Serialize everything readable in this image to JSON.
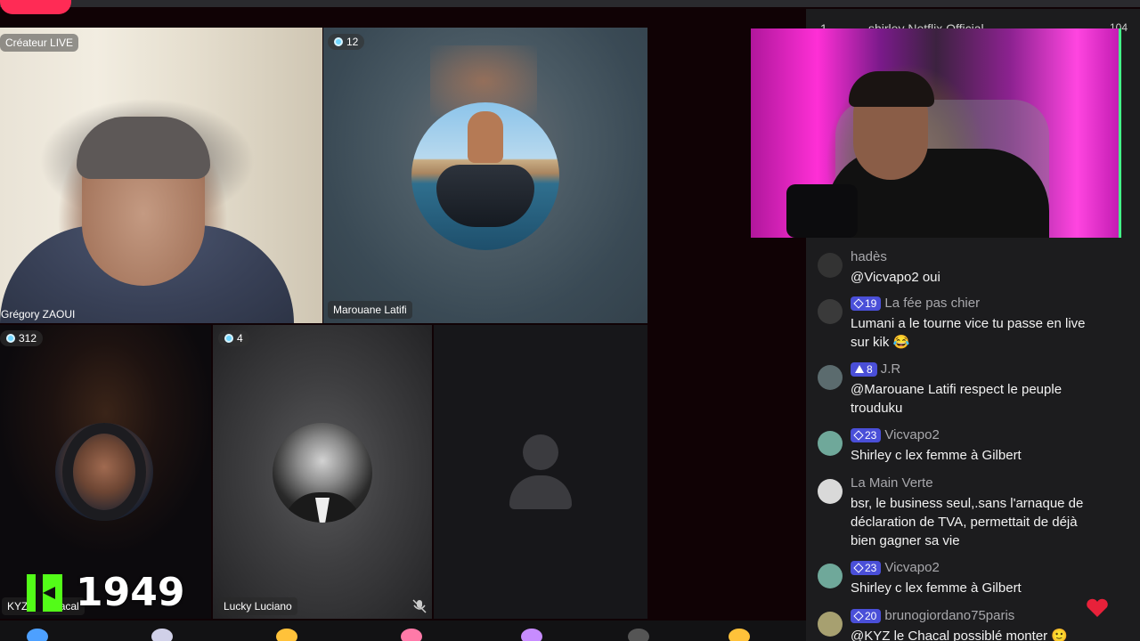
{
  "stream": {
    "host_badge": "Créateur LIVE",
    "host_name": "Grégory ZAOUI",
    "tiles": [
      {
        "name": "Marouane Latifi",
        "viewers": "12"
      },
      {
        "name": "KYZ Le Chacal",
        "viewers": "312"
      },
      {
        "name": "Lucky Luciano",
        "viewers": "4"
      }
    ],
    "kick_count": "1949",
    "kick_color": "#53fc18"
  },
  "chat": {
    "top_rank": "1",
    "top_user": "shirley Netflix Official",
    "top_score": "104",
    "messages": [
      {
        "user": "hadès",
        "badge": "",
        "text": "@Vicvapo2 oui"
      },
      {
        "user": "La fée pas chier",
        "badge": "19",
        "text": "Lumani a le tourne vice tu passe en live sur kik 😂"
      },
      {
        "user": "J.R",
        "badge": "8",
        "text": "@Marouane Latifi respect le peuple trouduku"
      },
      {
        "user": "Vicvapo2",
        "badge": "23",
        "text": "Shirley c lex femme à Gilbert"
      },
      {
        "user": "La Main Verte",
        "badge": "",
        "text": "bsr, le business seul,.sans l'arnaque de déclaration de TVA, permettait de déjà bien gagner sa vie"
      },
      {
        "user": "Vicvapo2",
        "badge": "23",
        "text": "Shirley c lex femme à Gilbert"
      },
      {
        "user": "brunogiordano75paris",
        "badge": "20",
        "text": "@KYZ le Chacal possiblé monter 🙂"
      }
    ]
  },
  "colors": {
    "accent": "#ff2b55",
    "badge": "#4a4fd8",
    "chat_bg": "#1c1c1e"
  }
}
